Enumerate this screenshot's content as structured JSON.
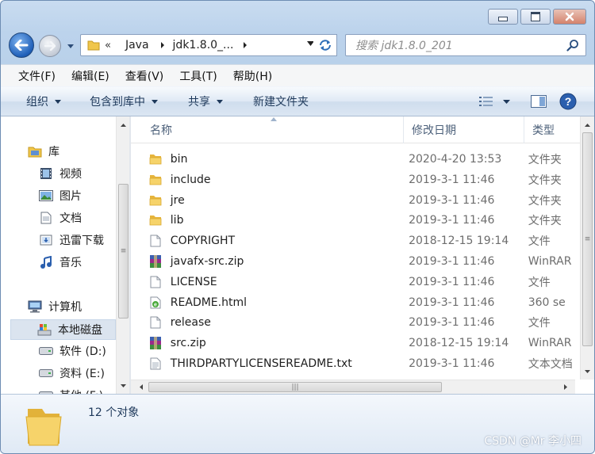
{
  "address": {
    "overflow": "«",
    "crumbs": [
      "Java",
      "jdk1.8.0_..."
    ]
  },
  "search": {
    "placeholder": "搜索 jdk1.8.0_201"
  },
  "menu": [
    "文件(F)",
    "编辑(E)",
    "查看(V)",
    "工具(T)",
    "帮助(H)"
  ],
  "toolbar": {
    "organize": "组织",
    "include_in_library": "包含到库中",
    "share": "共享",
    "new_folder": "新建文件夹"
  },
  "nav": {
    "library": "库",
    "videos": "视频",
    "pictures": "图片",
    "documents": "文档",
    "xunlei": "迅雷下载",
    "music": "音乐",
    "computer": "计算机",
    "local_disk": "本地磁盘",
    "drive_d": "软件 (D:)",
    "drive_e": "资料 (E:)",
    "drive_f": "其他 (F:)"
  },
  "columns": {
    "name": "名称",
    "modified": "修改日期",
    "type": "类型"
  },
  "files": [
    {
      "name": "bin",
      "modified": "2020-4-20 13:53",
      "type": "文件夹",
      "icon": "folder-icon"
    },
    {
      "name": "include",
      "modified": "2019-3-1 11:46",
      "type": "文件夹",
      "icon": "folder-icon"
    },
    {
      "name": "jre",
      "modified": "2019-3-1 11:46",
      "type": "文件夹",
      "icon": "folder-icon"
    },
    {
      "name": "lib",
      "modified": "2019-3-1 11:46",
      "type": "文件夹",
      "icon": "folder-icon"
    },
    {
      "name": "COPYRIGHT",
      "modified": "2018-12-15 19:14",
      "type": "文件",
      "icon": "file-icon"
    },
    {
      "name": "javafx-src.zip",
      "modified": "2019-3-1 11:46",
      "type": "WinRAR",
      "icon": "archive-icon"
    },
    {
      "name": "LICENSE",
      "modified": "2019-3-1 11:46",
      "type": "文件",
      "icon": "file-icon"
    },
    {
      "name": "README.html",
      "modified": "2019-3-1 11:46",
      "type": "360 se",
      "icon": "html-icon"
    },
    {
      "name": "release",
      "modified": "2019-3-1 11:46",
      "type": "文件",
      "icon": "file-icon"
    },
    {
      "name": "src.zip",
      "modified": "2018-12-15 19:14",
      "type": "WinRAR",
      "icon": "archive-icon"
    },
    {
      "name": "THIRDPARTYLICENSEREADME.txt",
      "modified": "2019-3-1 11:46",
      "type": "文本文档",
      "icon": "text-file-icon"
    }
  ],
  "status": {
    "item_count": "12 个对象"
  },
  "watermark": "CSDN @Mr 李小四",
  "colors": {
    "folder": "#f0c64b",
    "accent": "#1f5fb8",
    "chrome": "#bcd3ec"
  }
}
